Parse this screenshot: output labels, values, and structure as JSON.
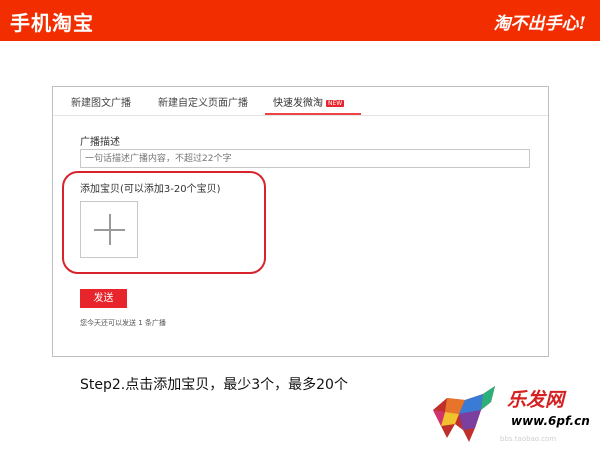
{
  "header": {
    "brand": "手机淘宝",
    "slogan": "淘不出手心!",
    "bg_color": "#f22e00"
  },
  "tabs": [
    {
      "label": "新建图文广播",
      "active": false
    },
    {
      "label": "新建自定义页面广播",
      "active": false
    },
    {
      "label": "快速发微淘",
      "active": true,
      "badge": "NEW"
    }
  ],
  "form": {
    "description_label": "广播描述",
    "description_placeholder": "一句话描述广播内容，不超过22个字",
    "add_items_label": "添加宝贝(可以添加3-20个宝贝)",
    "add_icon": "plus-icon",
    "send_label": "发送",
    "hint": "您今天还可以发送 1 条广播"
  },
  "caption": "Step2.点击添加宝贝，最少3个，最多20个",
  "watermark": {
    "title": "乐发网",
    "url": "www.6pf.cn",
    "url2": "bbs.taobao.com"
  },
  "colors": {
    "accent": "#e8242c",
    "highlight": "#d8232c"
  }
}
